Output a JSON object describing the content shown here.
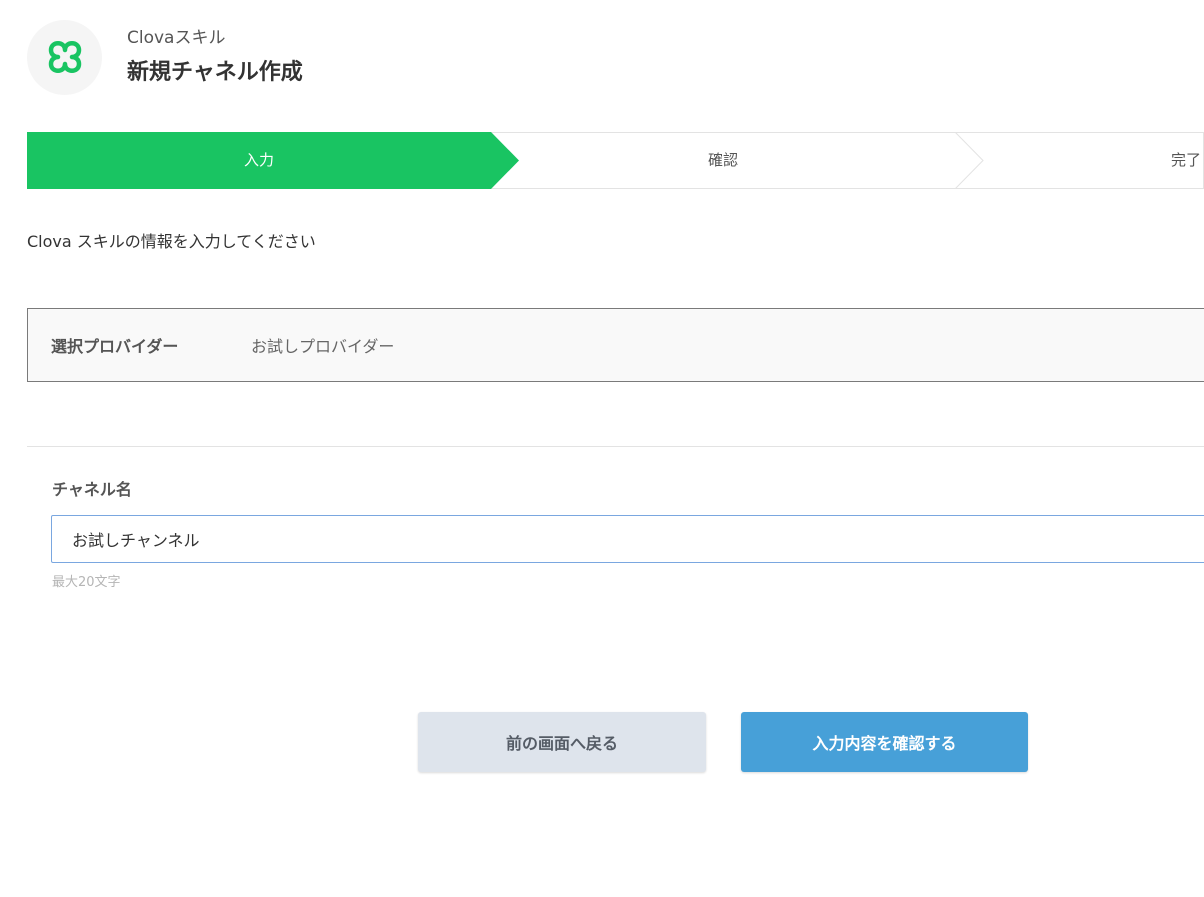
{
  "header": {
    "service_name": "Clovaスキル",
    "title": "新規チャネル作成",
    "logo_icon": "clover-icon",
    "logo_color": "#19c462"
  },
  "stepper": {
    "steps": [
      {
        "label": "入力",
        "active": true
      },
      {
        "label": "確認",
        "active": false
      },
      {
        "label": "完了",
        "active": false
      }
    ],
    "active_color": "#19c462"
  },
  "instruction": "Clova スキルの情報を入力してください",
  "provider": {
    "label": "選択プロバイダー",
    "value": "お試しプロバイダー"
  },
  "channel_name": {
    "label": "チャネル名",
    "value": "お試しチャンネル",
    "hint": "最大20文字"
  },
  "buttons": {
    "back": "前の画面へ戻る",
    "confirm": "入力内容を確認する"
  }
}
